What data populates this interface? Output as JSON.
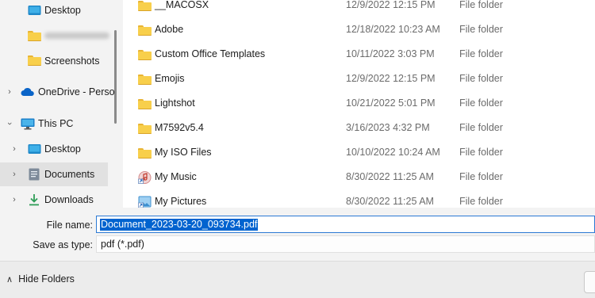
{
  "nav": {
    "items": [
      {
        "label": "Desktop",
        "icon": "desktop-icon"
      },
      {
        "label": "",
        "icon": "folder-icon"
      },
      {
        "label": "Screenshots",
        "icon": "folder-icon"
      },
      {
        "label": "OneDrive - Perso",
        "icon": "cloud-icon"
      },
      {
        "label": "This PC",
        "icon": "monitor-icon"
      },
      {
        "label": "Desktop",
        "icon": "desktop-icon"
      },
      {
        "label": "Documents",
        "icon": "documents-icon",
        "selected": true
      },
      {
        "label": "Downloads",
        "icon": "download-icon"
      }
    ]
  },
  "files": [
    {
      "name": "__MACOSX",
      "date": "12/9/2022 12:15 PM",
      "type": "File folder",
      "icon": "folder-icon"
    },
    {
      "name": "Adobe",
      "date": "12/18/2022 10:23 AM",
      "type": "File folder",
      "icon": "folder-icon"
    },
    {
      "name": "Custom Office Templates",
      "date": "10/11/2022 3:03 PM",
      "type": "File folder",
      "icon": "folder-icon"
    },
    {
      "name": "Emojis",
      "date": "12/9/2022 12:15 PM",
      "type": "File folder",
      "icon": "folder-icon"
    },
    {
      "name": "Lightshot",
      "date": "10/21/2022 5:01 PM",
      "type": "File folder",
      "icon": "folder-icon"
    },
    {
      "name": "M7592v5.4",
      "date": "3/16/2023 4:32 PM",
      "type": "File folder",
      "icon": "folder-icon"
    },
    {
      "name": "My ISO Files",
      "date": "10/10/2022 10:24 AM",
      "type": "File folder",
      "icon": "folder-icon"
    },
    {
      "name": "My Music",
      "date": "8/30/2022 11:25 AM",
      "type": "File folder",
      "icon": "music-shortcut-icon"
    },
    {
      "name": "My Pictures",
      "date": "8/30/2022 11:25 AM",
      "type": "File folder",
      "icon": "pictures-shortcut-icon"
    }
  ],
  "form": {
    "file_name_label": "File name:",
    "file_name_value": "Document_2023-03-20_093734.pdf",
    "save_type_label": "Save as type:",
    "save_type_value": "pdf (*.pdf)"
  },
  "footer": {
    "hide_folders_label": "Hide Folders"
  },
  "colors": {
    "selection": "#0063cf",
    "folder": "#f8cf4b",
    "focus_border": "#2b79d4"
  }
}
